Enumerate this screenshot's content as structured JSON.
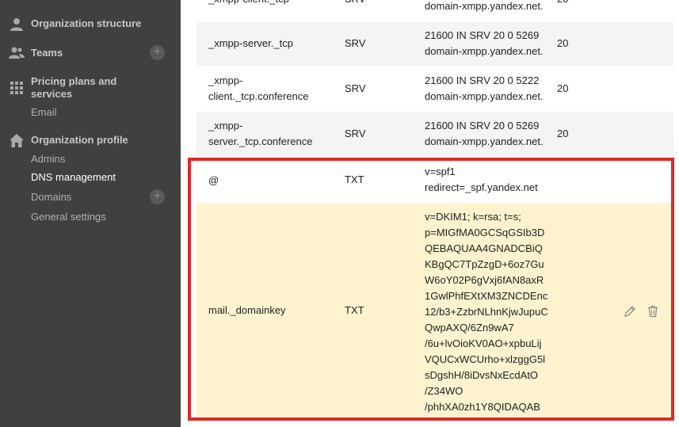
{
  "sidebar": {
    "org_structure": "Organization structure",
    "teams": "Teams",
    "pricing_line1": "Pricing plans and",
    "pricing_line2": "services",
    "email": "Email",
    "org_profile": "Organization profile",
    "admins": "Admins",
    "dns_management": "DNS management",
    "domains": "Domains",
    "general_settings": "General settings",
    "plus": "+"
  },
  "records": [
    {
      "host": "_xmpp-client._tcp",
      "type": "SRV",
      "value": "domain-xmpp.yandex.net.",
      "priority": "20"
    },
    {
      "host": "_xmpp-server._tcp",
      "type": "SRV",
      "value": "21600 IN SRV 20 0 5269\ndomain-xmpp.yandex.net.",
      "priority": "20"
    },
    {
      "host": "_xmpp-\nclient._tcp.conference",
      "type": "SRV",
      "value": "21600 IN SRV 20 0 5222\ndomain-xmpp.yandex.net.",
      "priority": "20"
    },
    {
      "host": "_xmpp-\nserver._tcp.conference",
      "type": "SRV",
      "value": "21600 IN SRV 20 0 5269\ndomain-xmpp.yandex.net.",
      "priority": "20"
    },
    {
      "host": "@",
      "type": "TXT",
      "value": "v=spf1\nredirect=_spf.yandex.net",
      "priority": ""
    },
    {
      "host": "mail._domainkey",
      "type": "TXT",
      "value": "v=DKIM1; k=rsa; t=s;\np=MIGfMA0GCSqGSIb3D\nQEBAQUAA4GNADCBiQ\nKBgQC7TpZzgD+6oz7Gu\nW6oY02P6gVxj6fAN8axR\n1GwlPhfEXtXM3ZNCDEnc\n12/b3+ZzbrNLhnKjwJupuC\nQwpAXQ/6Zn9wA7\n/6u+lvOioKV0AO+xpbuLij\nVQUCxWCUrho+xlzggG5l\nsDgshH/8iDvsNxEcdAtO\n/Z34WO\n/phhXA0zh1Y8QIDAQAB",
      "priority": ""
    }
  ]
}
